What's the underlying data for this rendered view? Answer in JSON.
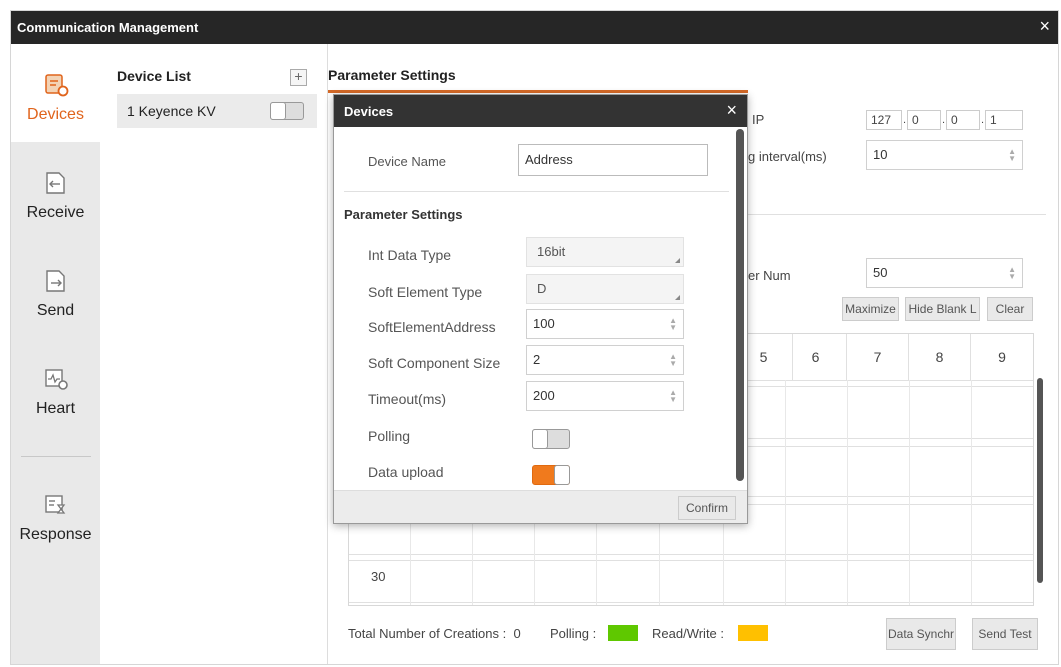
{
  "window": {
    "title": "Communication Management",
    "close_glyph": "×"
  },
  "nav": {
    "items": [
      {
        "label": "Devices",
        "icon": "devices-icon"
      },
      {
        "label": "Receive",
        "icon": "receive-icon"
      },
      {
        "label": "Send",
        "icon": "send-icon"
      },
      {
        "label": "Heart",
        "icon": "heart-icon"
      },
      {
        "label": "Response",
        "icon": "response-icon"
      }
    ],
    "active": "Devices",
    "accent": "#e0641c"
  },
  "device_list": {
    "title": "Device List",
    "add_glyph": "+",
    "devices": [
      {
        "name": "1 Keyence KV",
        "enabled": false
      }
    ]
  },
  "main": {
    "title": "Parameter Settings",
    "ip_label": "IP",
    "ip": [
      "127",
      "0",
      "0",
      "1"
    ],
    "ip_separator": ".",
    "interval_label": "g interval(ms)",
    "interval_value": "10",
    "register_label": "er Num",
    "register_value": "50",
    "buttons": {
      "maximize": "Maximize",
      "hide_blank": "Hide Blank L",
      "clear": "Clear"
    },
    "grid_columns": [
      "5",
      "6",
      "7",
      "8",
      "9"
    ],
    "row_label": "30",
    "footer": {
      "total_label": "Total Number of Creations :  0",
      "polling_label": "Polling :",
      "polling_color": "#5fc800",
      "rw_label": "Read/Write :",
      "rw_color": "#ffc000",
      "data_sync": "Data Synchr",
      "send_test": "Send Test"
    }
  },
  "dialog": {
    "title": "Devices",
    "close_glyph": "×",
    "device_name_label": "Device Name",
    "device_name_value": "Address",
    "section": "Parameter Settings",
    "fields": {
      "int_data_type": {
        "label": "Int Data Type",
        "value": "16bit"
      },
      "soft_element_type": {
        "label": "Soft Element Type",
        "value": "D"
      },
      "soft_element_address": {
        "label": "SoftElementAddress",
        "value": "100"
      },
      "soft_component_size": {
        "label": "Soft Component Size",
        "value": "2"
      },
      "timeout": {
        "label": "Timeout(ms)",
        "value": "200"
      }
    },
    "polling": {
      "label": "Polling",
      "on": false
    },
    "data_upload": {
      "label": "Data upload",
      "on": true
    },
    "confirm": "Confirm",
    "spin_glyph": "▲▼"
  }
}
